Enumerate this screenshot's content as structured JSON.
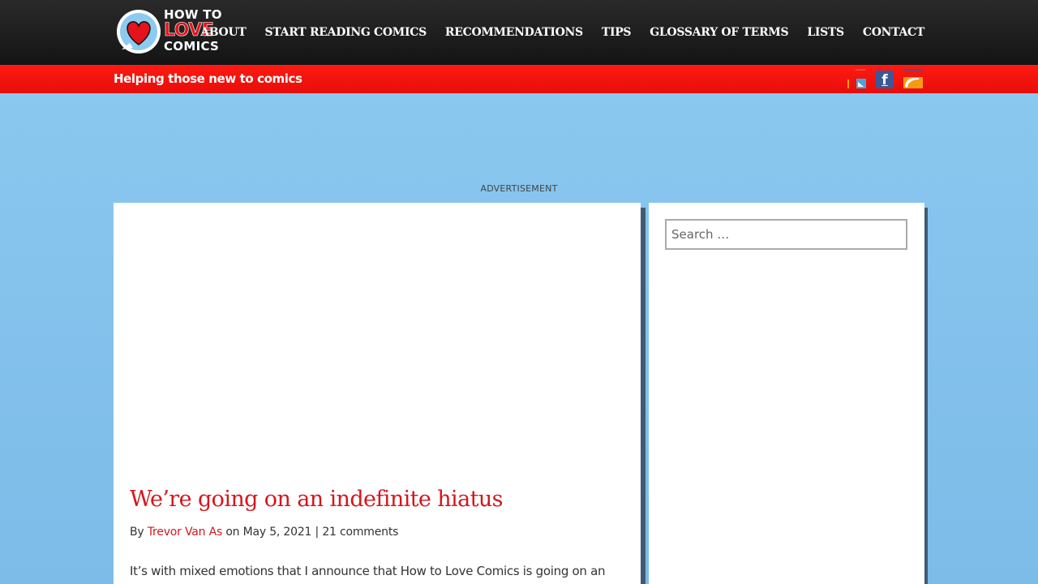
{
  "header": {
    "logo": {
      "line1": "HOW TO",
      "line2": "LOVE",
      "line3": "COMICS"
    },
    "nav": [
      {
        "label": "ABOUT"
      },
      {
        "label": "START READING COMICS"
      },
      {
        "label": "RECOMMENDATIONS"
      },
      {
        "label": "TIPS"
      },
      {
        "label": "GLOSSARY OF TERMS"
      },
      {
        "label": "LISTS"
      },
      {
        "label": "CONTACT"
      }
    ],
    "tagline": "Helping those new to comics",
    "social": {
      "twitter_icon": "twitter-icon",
      "facebook_icon": "facebook-icon",
      "facebook_glyph": "f",
      "rss_icon": "rss-icon"
    }
  },
  "ad": {
    "label": "ADVERTISEMENT"
  },
  "post": {
    "title": "We’re going on an indefinite hiatus",
    "by": "By",
    "author": "Trevor Van As",
    "on": "on",
    "date": "May 5, 2021",
    "separator": "|",
    "comments": "21 comments",
    "excerpt": "It’s with mixed emotions that I announce that How to Love Comics is going on an"
  },
  "sidebar": {
    "search": {
      "placeholder": "Search …",
      "value": ""
    }
  },
  "colors": {
    "accent_red": "#d4161c",
    "header_bg": "#1b1b1b",
    "redbar": "#ee110d",
    "page_bg": "#86c4ee",
    "facebook_blue": "#3b5998"
  }
}
